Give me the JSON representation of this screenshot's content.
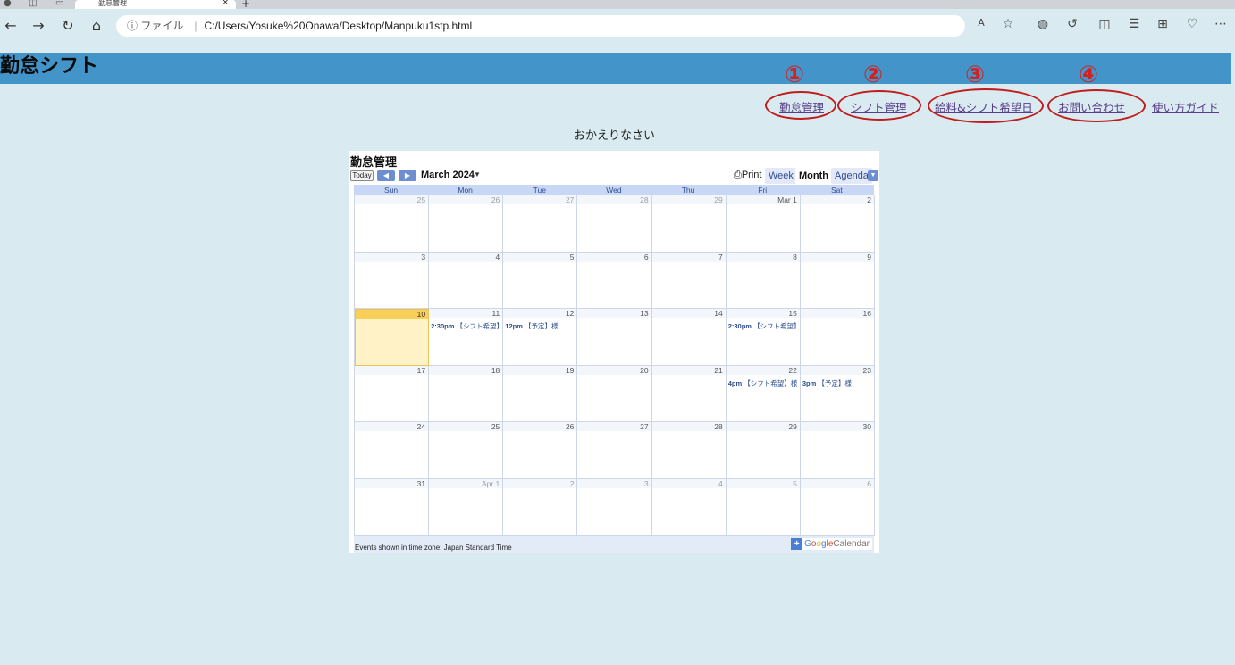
{
  "browser": {
    "tab_title": "勤怠管理",
    "tab_close": "×",
    "new_tab": "+",
    "url_info": "ⓘ ファイル",
    "url": "C:/Users/Yosuke%20Onawa/Desktop/Manpuku1stp.html"
  },
  "page": {
    "header_title": "勤怠シフト",
    "welcome": "おかえりなさい"
  },
  "nav": {
    "links": [
      {
        "label": "勤怠管理",
        "mark": "①"
      },
      {
        "label": "シフト管理",
        "mark": "②"
      },
      {
        "label": "給料&シフト希望日",
        "mark": "③"
      },
      {
        "label": "お問い合わせ",
        "mark": "④"
      },
      {
        "label": "使い方ガイド"
      }
    ]
  },
  "calendar": {
    "title": "勤怠管理",
    "today_label": "Today",
    "month_label": "March 2024",
    "print_label": "Print",
    "views": [
      "Week",
      "Month",
      "Agenda"
    ],
    "active_view": "Month",
    "weekdays": [
      "Sun",
      "Mon",
      "Tue",
      "Wed",
      "Thu",
      "Fri",
      "Sat"
    ],
    "weeks": [
      [
        {
          "d": "25",
          "o": true
        },
        {
          "d": "26",
          "o": true
        },
        {
          "d": "27",
          "o": true
        },
        {
          "d": "28",
          "o": true
        },
        {
          "d": "29",
          "o": true
        },
        {
          "d": "Mar 1"
        },
        {
          "d": "2"
        }
      ],
      [
        {
          "d": "3"
        },
        {
          "d": "4"
        },
        {
          "d": "5"
        },
        {
          "d": "6"
        },
        {
          "d": "7"
        },
        {
          "d": "8"
        },
        {
          "d": "9"
        }
      ],
      [
        {
          "d": "10",
          "today": true
        },
        {
          "d": "11",
          "t": "2:30pm",
          "e": "【シフト希望】"
        },
        {
          "d": "12",
          "t": "12pm",
          "e": "【予定】様"
        },
        {
          "d": "13"
        },
        {
          "d": "14"
        },
        {
          "d": "15",
          "t": "2:30pm",
          "e": "【シフト希望】"
        },
        {
          "d": "16"
        }
      ],
      [
        {
          "d": "17"
        },
        {
          "d": "18"
        },
        {
          "d": "19"
        },
        {
          "d": "20"
        },
        {
          "d": "21"
        },
        {
          "d": "22",
          "t": "4pm",
          "e": "【シフト希望】様"
        },
        {
          "d": "23",
          "t": "3pm",
          "e": "【予定】様"
        }
      ],
      [
        {
          "d": "24"
        },
        {
          "d": "25"
        },
        {
          "d": "26"
        },
        {
          "d": "27"
        },
        {
          "d": "28"
        },
        {
          "d": "29"
        },
        {
          "d": "30"
        }
      ],
      [
        {
          "d": "31"
        },
        {
          "d": "Apr 1",
          "o": true
        },
        {
          "d": "2",
          "o": true
        },
        {
          "d": "3",
          "o": true
        },
        {
          "d": "4",
          "o": true
        },
        {
          "d": "5",
          "o": true
        },
        {
          "d": "6",
          "o": true
        }
      ]
    ],
    "timezone_note": "Events shown in time zone: Japan Standard Time",
    "google_label_parts": [
      "G",
      "o",
      "o",
      "g",
      "l",
      "e"
    ],
    "calendar_word": "Calendar"
  },
  "colors": {
    "header_bg": "#4394c8",
    "page_bg": "#d9ebf0",
    "annotation_red": "#c21b1b",
    "link": "#5a3d8a"
  }
}
